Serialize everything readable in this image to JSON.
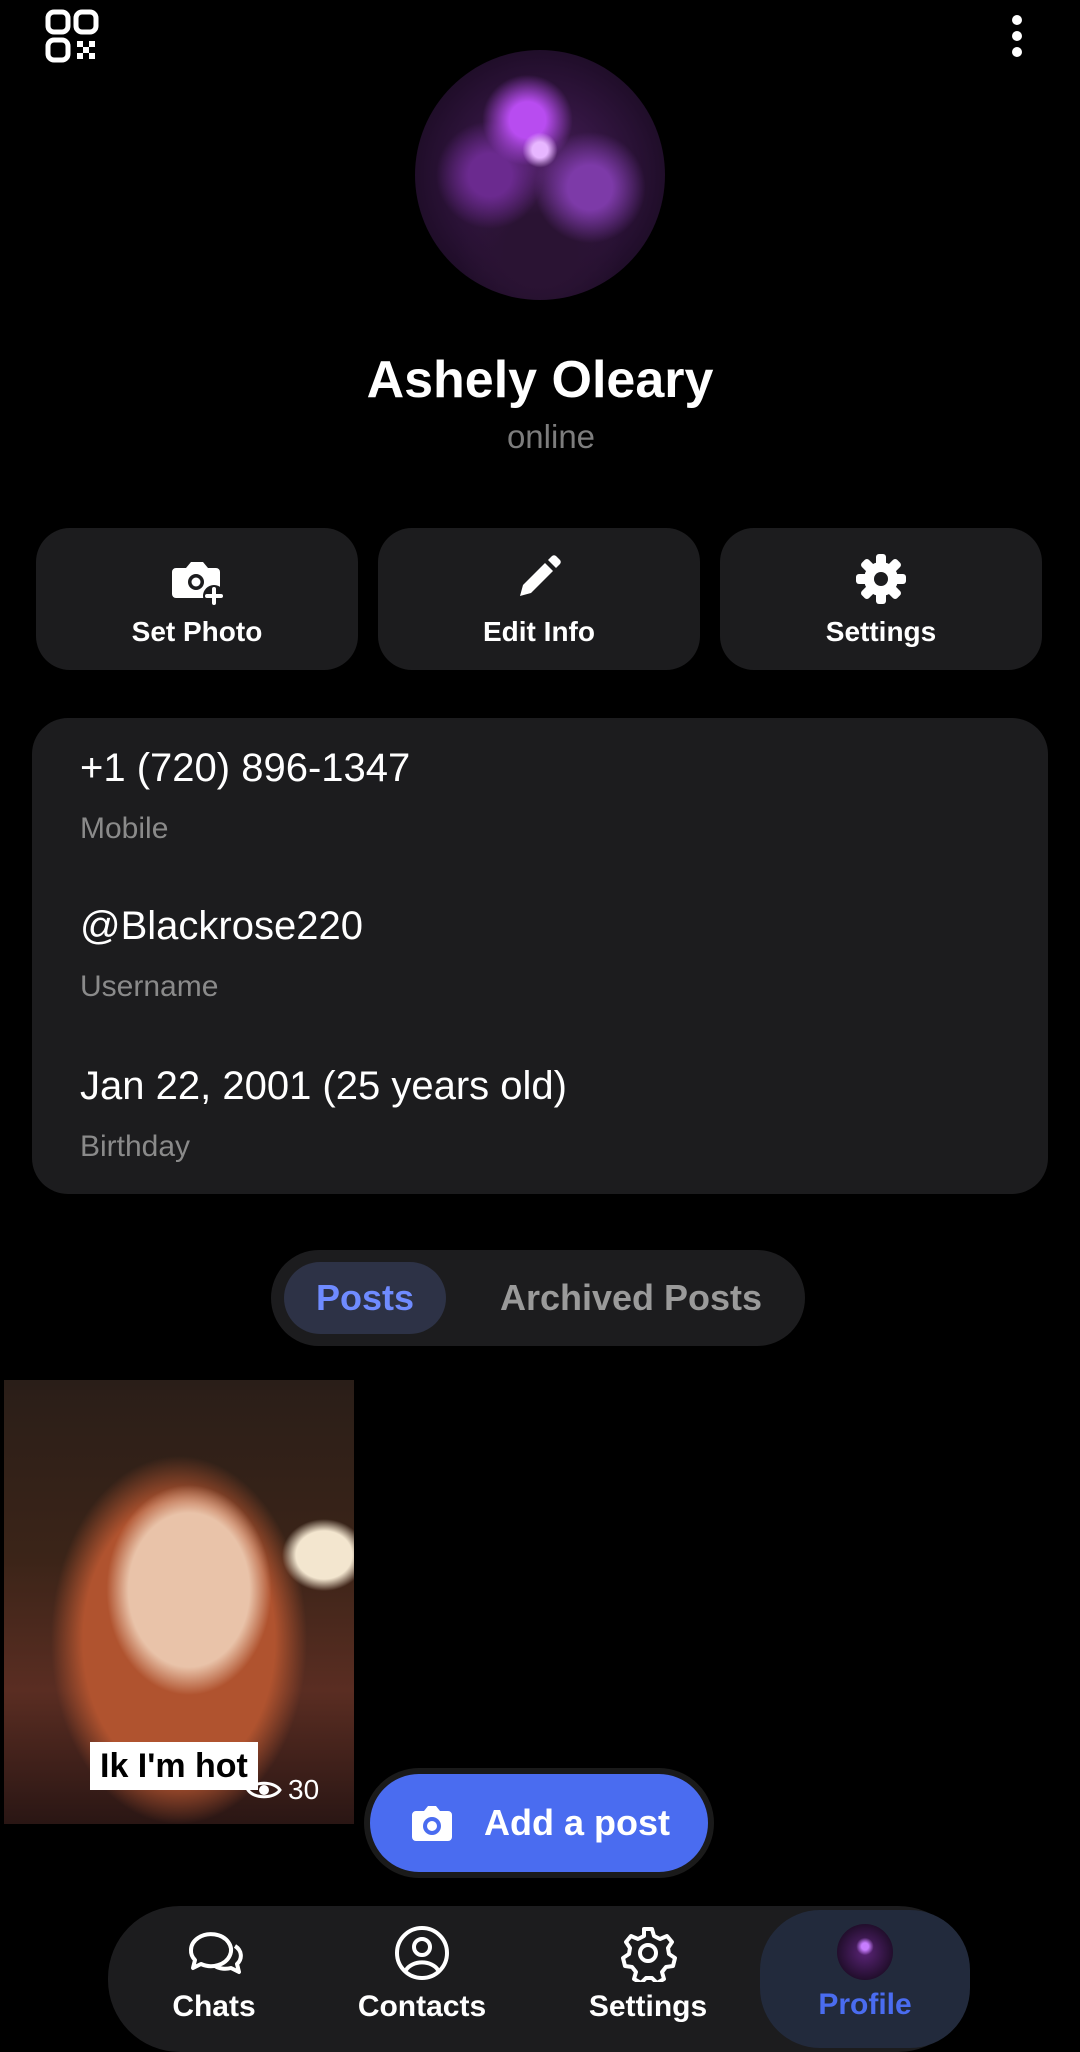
{
  "profile": {
    "name": "Ashely Oleary",
    "status": "online"
  },
  "actions": {
    "set_photo": "Set Photo",
    "edit_info": "Edit Info",
    "settings": "Settings"
  },
  "info": {
    "phone": "+1 (720) 896-1347",
    "phone_label": "Mobile",
    "username": "@Blackrose220",
    "username_label": "Username",
    "birthday": "Jan 22, 2001 (25 years old)",
    "birthday_label": "Birthday"
  },
  "tabs": {
    "posts": "Posts",
    "archived": "Archived Posts",
    "active": "Posts"
  },
  "post": {
    "caption": "Ik I'm hot",
    "views": "30"
  },
  "add_post": "Add a post",
  "nav": {
    "chats": "Chats",
    "contacts": "Contacts",
    "settings": "Settings",
    "profile": "Profile",
    "active": "Profile"
  },
  "colors": {
    "accent": "#4a6cf0",
    "active_text": "#6f8bff",
    "card": "#1c1c1e"
  },
  "icons": [
    "qr-code-icon",
    "more-vertical-icon",
    "camera-plus-icon",
    "pencil-icon",
    "gear-icon",
    "eye-icon",
    "camera-icon",
    "chat-bubbles-icon",
    "user-circle-icon"
  ]
}
